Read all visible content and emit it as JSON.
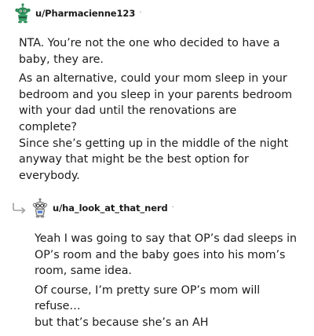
{
  "comments": [
    {
      "username": "u/Pharmacienne123",
      "separator": "·",
      "avatar_icon": "snoo-avatar-icon",
      "paragraphs": [
        "NTA. You’re not the one who decided to have a\nbaby, they are.",
        "As an alternative, could your mom sleep in your\nbedroom and you sleep in your parents bedroom\nwith your dad until the renovations are complete?\nSince she’s getting up in the middle of the night\nanyway that might be the best option for\neverybody."
      ]
    },
    {
      "username": "u/ha_look_at_that_nerd",
      "separator": "·",
      "avatar_icon": "snoo-avatar-icon",
      "reply_icon": "reply-arrow-icon",
      "paragraphs": [
        "Yeah I was going to say that OP’s dad sleeps in\nOP’s room and the baby goes into his mom’s\nroom, same idea.",
        "Of course, I’m pretty sure OP’s mom will refuse…\nbut that’s because she’s an AH"
      ]
    }
  ],
  "colors": {
    "text": "#1c1c1c",
    "meta": "#7c7c7c",
    "avatar_green": "#2e8b57",
    "reply_arrow": "#a0a0a0"
  }
}
